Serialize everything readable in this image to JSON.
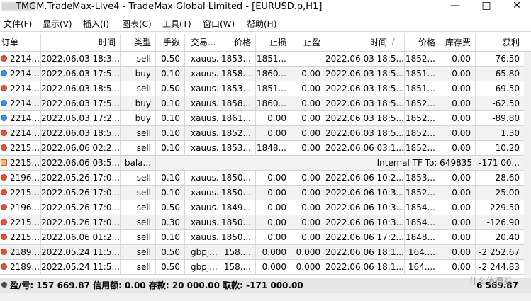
{
  "window": {
    "title": "TMGM.TradeMax-Live4 - TradeMax Global Limited - [EURUSD.p,H1]",
    "minimize_glyph": "—",
    "maximize_glyph": "□",
    "close_glyph": "✕"
  },
  "menu": [
    "文件(F)",
    "显示(V)",
    "插入(I)",
    "图表(C)",
    "工具(T)",
    "窗口(W)",
    "帮助(H)"
  ],
  "table": {
    "columns": [
      "订单",
      "时间",
      "类型",
      "手数",
      "交易...",
      "价格",
      "止损",
      "止盈",
      "时间",
      "价格",
      "库存费",
      "获利"
    ],
    "sort_indicator": "/",
    "rows": [
      {
        "order": "2214...",
        "open_time": "2022.06.03 18:3...",
        "type": "sell",
        "lots": "0.50",
        "symbol": "xauus...",
        "open_price": "1853...",
        "sl": "1851...",
        "tp": "",
        "close_time": "2022.06.03 18:5...",
        "close_price": "1852...",
        "swap": "0.00",
        "profit": "76.50"
      },
      {
        "order": "2214...",
        "open_time": "2022.06.03 17:5...",
        "type": "buy",
        "lots": "0.10",
        "symbol": "xauus...",
        "open_price": "1858...",
        "sl": "1860...",
        "tp": "0.00",
        "close_time": "2022.06.03 18:5...",
        "close_price": "1851...",
        "swap": "0.00",
        "profit": "-65.80"
      },
      {
        "order": "2214...",
        "open_time": "2022.06.03 18:5...",
        "type": "sell",
        "lots": "0.50",
        "symbol": "xauus...",
        "open_price": "1853...",
        "sl": "1851...",
        "tp": "0.00",
        "close_time": "2022.06.03 18:5...",
        "close_price": "1851...",
        "swap": "0.00",
        "profit": "69.50"
      },
      {
        "order": "2214...",
        "open_time": "2022.06.03 17:5...",
        "type": "buy",
        "lots": "0.10",
        "symbol": "xauus...",
        "open_price": "1858...",
        "sl": "1860...",
        "tp": "0.00",
        "close_time": "2022.06.03 18:5...",
        "close_price": "1852...",
        "swap": "0.00",
        "profit": "-62.50"
      },
      {
        "order": "2214...",
        "open_time": "2022.06.03 17:2...",
        "type": "buy",
        "lots": "0.10",
        "symbol": "xauus...",
        "open_price": "1861...",
        "sl": "0.00",
        "tp": "0.00",
        "close_time": "2022.06.03 18:5...",
        "close_price": "1852...",
        "swap": "0.00",
        "profit": "-89.80"
      },
      {
        "order": "2214...",
        "open_time": "2022.06.03 18:5...",
        "type": "sell",
        "lots": "0.10",
        "symbol": "xauus...",
        "open_price": "1852...",
        "sl": "0.00",
        "tp": "0.00",
        "close_time": "2022.06.03 18:5...",
        "close_price": "1852...",
        "swap": "0.00",
        "profit": "1.30"
      },
      {
        "order": "2215...",
        "open_time": "2022.06.06 02:2...",
        "type": "sell",
        "lots": "0.10",
        "symbol": "xauus...",
        "open_price": "1853...",
        "sl": "1848...",
        "tp": "0.00",
        "close_time": "2022.06.06 03:1...",
        "close_price": "1852...",
        "swap": "0.00",
        "profit": "10.20"
      },
      {
        "order": "2215...",
        "open_time": "2022.06.06 03:5...",
        "type": "bala...",
        "comment": "Internal TF To: 649835",
        "profit": "-171 00..."
      },
      {
        "order": "2196...",
        "open_time": "2022.05.26 17:0...",
        "type": "sell",
        "lots": "0.10",
        "symbol": "xauus...",
        "open_price": "1850...",
        "sl": "0.00",
        "tp": "0.00",
        "close_time": "2022.06.06 10:2...",
        "close_price": "1853...",
        "swap": "0.00",
        "profit": "-28.60"
      },
      {
        "order": "2215...",
        "open_time": "2022.05.26 17:0...",
        "type": "sell",
        "lots": "0.10",
        "symbol": "xauus...",
        "open_price": "1850...",
        "sl": "0.00",
        "tp": "0.00",
        "close_time": "2022.06.06 10:3...",
        "close_price": "1852...",
        "swap": "0.00",
        "profit": "-25.00"
      },
      {
        "order": "2196...",
        "open_time": "2022.05.26 17:0...",
        "type": "sell",
        "lots": "0.50",
        "symbol": "xauus...",
        "open_price": "1849...",
        "sl": "0.00",
        "tp": "0.00",
        "close_time": "2022.06.06 10:3...",
        "close_price": "1854...",
        "swap": "0.00",
        "profit": "-229.50"
      },
      {
        "order": "2215...",
        "open_time": "2022.05.26 17:0...",
        "type": "sell",
        "lots": "0.30",
        "symbol": "xauus...",
        "open_price": "1850...",
        "sl": "0.00",
        "tp": "0.00",
        "close_time": "2022.06.06 10:3...",
        "close_price": "1854...",
        "swap": "0.00",
        "profit": "-126.90"
      },
      {
        "order": "2215...",
        "open_time": "2022.06.06 01:2...",
        "type": "sell",
        "lots": "0.10",
        "symbol": "xauus...",
        "open_price": "1850...",
        "sl": "0.00",
        "tp": "0.00",
        "close_time": "2022.06.06 17:2...",
        "close_price": "1848...",
        "swap": "0.00",
        "profit": "20.40"
      },
      {
        "order": "2189...",
        "open_time": "2022.05.24 11:5...",
        "type": "sell",
        "lots": "0.50",
        "symbol": "gbpj...",
        "open_price": "158....",
        "sl": "0.000",
        "tp": "0.000",
        "close_time": "2022.06.06 18:1...",
        "close_price": "164....",
        "swap": "0.00",
        "profit": "-2 252.67"
      },
      {
        "order": "2189...",
        "open_time": "2022.05.24 11:5...",
        "type": "sell",
        "lots": "0.50",
        "symbol": "gbpj...",
        "open_price": "158....",
        "sl": "0.000",
        "tp": "0.000",
        "close_time": "2022.06.06 18:1...",
        "close_price": "164....",
        "swap": "0.00",
        "profit": "-2 244.83"
      }
    ]
  },
  "status": {
    "summary": "盈/亏: 157 669.87  信用额: 0.00  存款: 20 000.00  取款: -171 000.00",
    "total": "6 569.87"
  },
  "watermark": "什么值得买",
  "colors": {
    "sell_icon": "#e5533d",
    "buy_icon": "#3b8ee6",
    "balance_icon": "#f3b27a",
    "alt_row": "#f2f2f2"
  }
}
